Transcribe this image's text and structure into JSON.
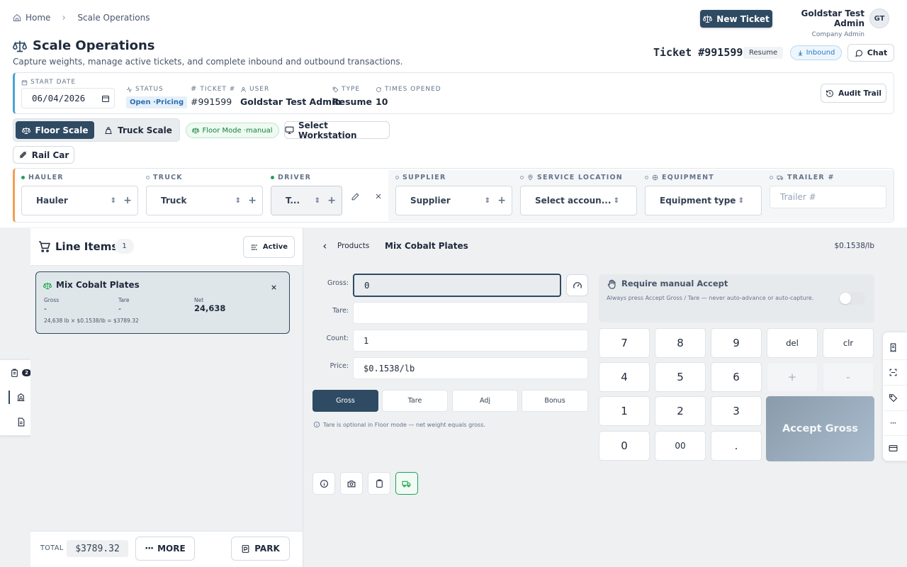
{
  "breadcrumb": {
    "home": "Home",
    "current": "Scale Operations"
  },
  "header": {
    "new_ticket": "New Ticket",
    "user_name": "Goldstar Test Admin",
    "user_role": "Company Admin",
    "avatar": "GT",
    "title": "Scale Operations",
    "subtitle": "Capture weights, manage active tickets, and complete inbound and outbound transactions.",
    "ticket_label": "Ticket #991599",
    "resume_badge": "Resume",
    "inbound": "Inbound",
    "chat": "Chat"
  },
  "info_bar": {
    "start_date_label": "START DATE",
    "start_date": "06/04/2026",
    "status_label": "STATUS",
    "status_value": "Open ·Pricing",
    "ticket_label": "TICKET #",
    "ticket_value": "#991599",
    "user_label": "USER",
    "user_value": "Goldstar Test Admin",
    "type_label": "TYPE",
    "type_value": "Resume",
    "times_label": "TIMES OPENED",
    "times_value": "10",
    "audit": "Audit Trail"
  },
  "modes": {
    "floor": "Floor Scale",
    "truck": "Truck Scale",
    "floor_mode": "Floor Mode ·manual",
    "workstation": "Select Workstation",
    "rail": "Rail Car"
  },
  "fields": {
    "hauler_label": "HAULER",
    "hauler": "Hauler",
    "truck_label": "TRUCK",
    "truck": "Truck",
    "driver_label": "DRIVER",
    "driver": "T...",
    "supplier_label": "SUPPLIER",
    "supplier": "Supplier",
    "service_label": "SERVICE LOCATION",
    "service": "Select accoun...",
    "equipment_label": "EQUIPMENT",
    "equipment": "Equipment type",
    "trailer_label": "TRAILER #",
    "trailer_placeholder": "Trailer #"
  },
  "line_items": {
    "title": "Line Items",
    "count": "1",
    "filter": "Active",
    "item": {
      "name": "Mix Cobalt Plates",
      "gross_label": "Gross",
      "gross": "-",
      "tare_label": "Tare",
      "tare": "-",
      "net_label": "Net",
      "net": "24,638",
      "calc": "24,638 lb × $0.1538/lb = $3789.32"
    },
    "total_label": "TOTAL",
    "total": "$3789.32",
    "more": "MORE",
    "park": "PARK"
  },
  "side_rail": {
    "badge": "2"
  },
  "product": {
    "back": "Products",
    "name": "Mix Cobalt Plates",
    "price_rate": "$0.1538/lb",
    "gross_label": "Gross:",
    "gross_value": "0",
    "tare_label": "Tare:",
    "tare_value": "",
    "count_label": "Count:",
    "count_value": "1",
    "price_label": "Price:",
    "price_value": "$0.1538/lb",
    "buttons": [
      "Gross",
      "Tare",
      "Adj",
      "Bonus"
    ],
    "hint": "Tare is optional in Floor mode — net weight equals gross."
  },
  "manual_accept": {
    "title": "Require manual Accept",
    "desc": "Always press Accept Gross / Tare — never auto-advance or auto-capture."
  },
  "keypad": {
    "keys": [
      "7",
      "8",
      "9",
      "del",
      "clr",
      "4",
      "5",
      "6",
      "+",
      "-",
      "1",
      "2",
      "3",
      "0",
      "00",
      "."
    ],
    "accept": "Accept Gross"
  },
  "colors": {
    "primary": "#2f4a63",
    "accent_orange": "#f0a050",
    "accent_blue": "#4aa3d6",
    "success": "#16a34a"
  }
}
